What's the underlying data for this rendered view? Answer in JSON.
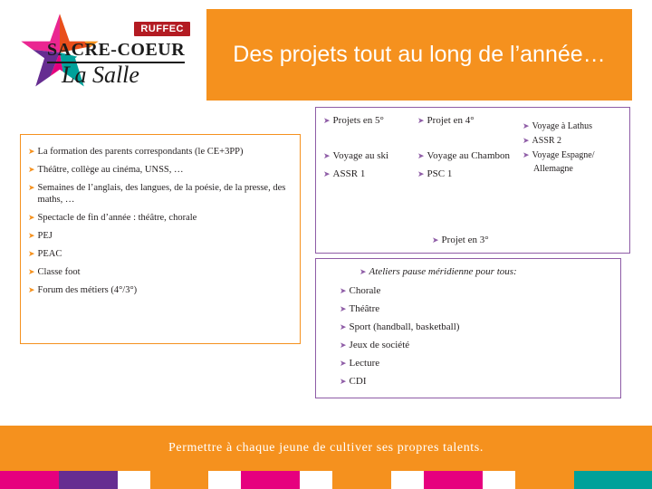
{
  "header": {
    "title": "Des projets tout au long de l’année…",
    "bg_color": "#F5911E",
    "text_color": "#FFFFFF"
  },
  "logo": {
    "badge": "RUFFEC",
    "name_line1": "SACRE-COEUR",
    "name_line2": "La Salle",
    "star_colors": [
      "#E94E1B",
      "#F5911E",
      "#E6007E",
      "#662D91",
      "#00A19A"
    ]
  },
  "left_box": {
    "border_color": "#F5911E",
    "items": [
      "La formation des parents correspondants (le CE+3PP)",
      "Théâtre, collège au cinéma, UNSS, …",
      "Semaines de l’anglais, des langues, de la poésie, de la presse, des maths, …",
      "Spectacle de fin d’année : théâtre, chorale",
      "PEJ",
      "PEAC",
      "Classe foot",
      "Forum des métiers (4°/3°)"
    ]
  },
  "mid_box": {
    "border_color": "#8E5CA6",
    "col_a_title": "Projets en 5°",
    "col_b_title": "Projet en 4°",
    "col_a_items": [
      "Voyage au ski",
      "ASSR 1"
    ],
    "col_b_items": [
      "Voyage au Chambon",
      "PSC 1"
    ],
    "col_c_items": [
      "Voyage à Lathus",
      "ASSR 2",
      "Voyage Espagne/"
    ],
    "col_c_note": "Allemagne",
    "proj3_title": "Projet en 3°"
  },
  "bottom_box": {
    "border_color": "#8E5CA6",
    "title": "Ateliers pause méridienne pour tous:",
    "items": [
      "Chorale",
      "Théâtre",
      "Sport (handball, basketball)",
      "Jeux de société",
      "Lecture",
      "CDI"
    ]
  },
  "footer": {
    "text": "Permettre à chaque jeune de cultiver ses propres talents.",
    "bg_color": "#F5911E",
    "strip_colors": [
      "#E6007E",
      "#662D91",
      "#F5911E",
      "#E6007E",
      "#F5911E",
      "#E6007E",
      "#F5911E",
      "#00A19A"
    ]
  }
}
